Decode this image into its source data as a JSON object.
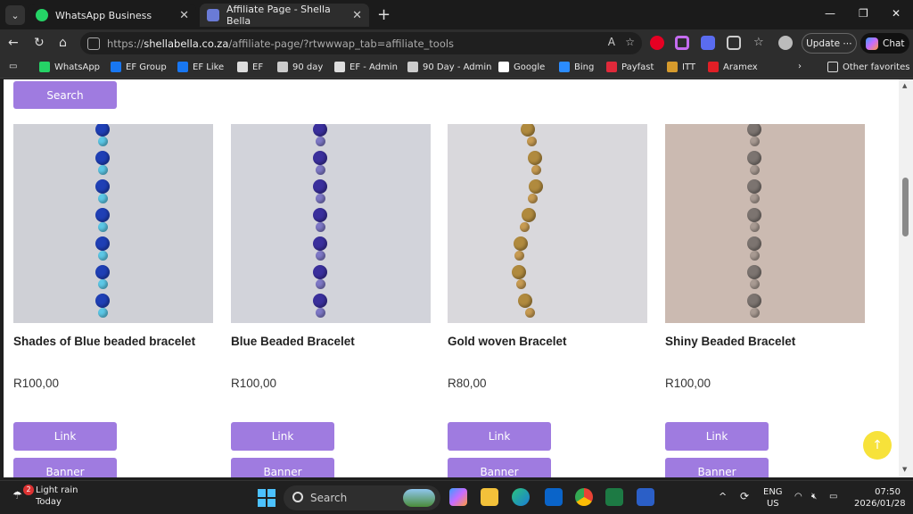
{
  "browser": {
    "tabs": [
      {
        "label": "WhatsApp Business",
        "close": "✕"
      },
      {
        "label": "Affiliate Page - Shella Bella",
        "close": "✕"
      }
    ],
    "new_tab": "+",
    "window_controls": [
      "—",
      "❐",
      "✕"
    ],
    "url": {
      "prefix": "https://",
      "domain": "shellabella.co.za",
      "path": "/affiliate-page/?rtwwwap_tab=affiliate_tools"
    },
    "update_label": "Update ⋯",
    "chat_label": "Chat",
    "bookmarks": [
      {
        "label": "WhatsApp",
        "icon": "whatsapp-icon",
        "color": "#25d366"
      },
      {
        "label": "EF Group",
        "icon": "facebook-icon",
        "color": "#1877f2"
      },
      {
        "label": "EF Like",
        "icon": "facebook-icon",
        "color": "#1877f2"
      },
      {
        "label": "EF",
        "icon": "grid-icon",
        "color": "#dddddd"
      },
      {
        "label": "90 day",
        "icon": "sheet-icon",
        "color": "#cccccc"
      },
      {
        "label": "EF - Admin",
        "icon": "grid-icon",
        "color": "#dddddd"
      },
      {
        "label": "90 Day - Admin",
        "icon": "sheet-icon",
        "color": "#cccccc"
      },
      {
        "label": "Google",
        "icon": "google-icon",
        "color": "#ffffff"
      },
      {
        "label": "Bing",
        "icon": "bing-icon",
        "color": "#2b8cff"
      },
      {
        "label": "Payfast",
        "icon": "payfast-icon",
        "color": "#e0293a"
      },
      {
        "label": "ITT",
        "icon": "itt-icon",
        "color": "#d69a2c"
      },
      {
        "label": "Aramex",
        "icon": "aramex-icon",
        "color": "#e01f26"
      }
    ],
    "other_favorites": "Other favorites"
  },
  "page": {
    "search_label": "Search",
    "products": [
      {
        "title": "Shades of Blue beaded bracelet",
        "price": "R100,00",
        "link_label": "Link",
        "banner_label": "Banner",
        "bead_colors": [
          "#1f3fb5",
          "#5cc7e6"
        ],
        "bg": "#cfd0d6"
      },
      {
        "title": "Blue Beaded Bracelet",
        "price": "R100,00",
        "link_label": "Link",
        "banner_label": "Banner",
        "bead_colors": [
          "#3a2f9c",
          "#7e78c6"
        ],
        "bg": "#d2d3da"
      },
      {
        "title": "Gold woven Bracelet",
        "price": "R80,00",
        "link_label": "Link",
        "banner_label": "Banner",
        "bead_colors": [
          "#b08a3e",
          "#c79b52"
        ],
        "bg": "#d9d8dc"
      },
      {
        "title": "Shiny Beaded Bracelet",
        "price": "R100,00",
        "link_label": "Link",
        "banner_label": "Banner",
        "bead_colors": [
          "#7c7470",
          "#a89a92"
        ],
        "bg": "#cbbab1"
      }
    ],
    "scroll_top_label": "↑"
  },
  "taskbar": {
    "weather": {
      "badge": "2",
      "condition": "Light rain",
      "day": "Today"
    },
    "search_placeholder": "Search",
    "tray": {
      "lang_top": "ENG",
      "lang_bottom": "US",
      "time": "07:50",
      "date": "2026/01/28"
    }
  }
}
